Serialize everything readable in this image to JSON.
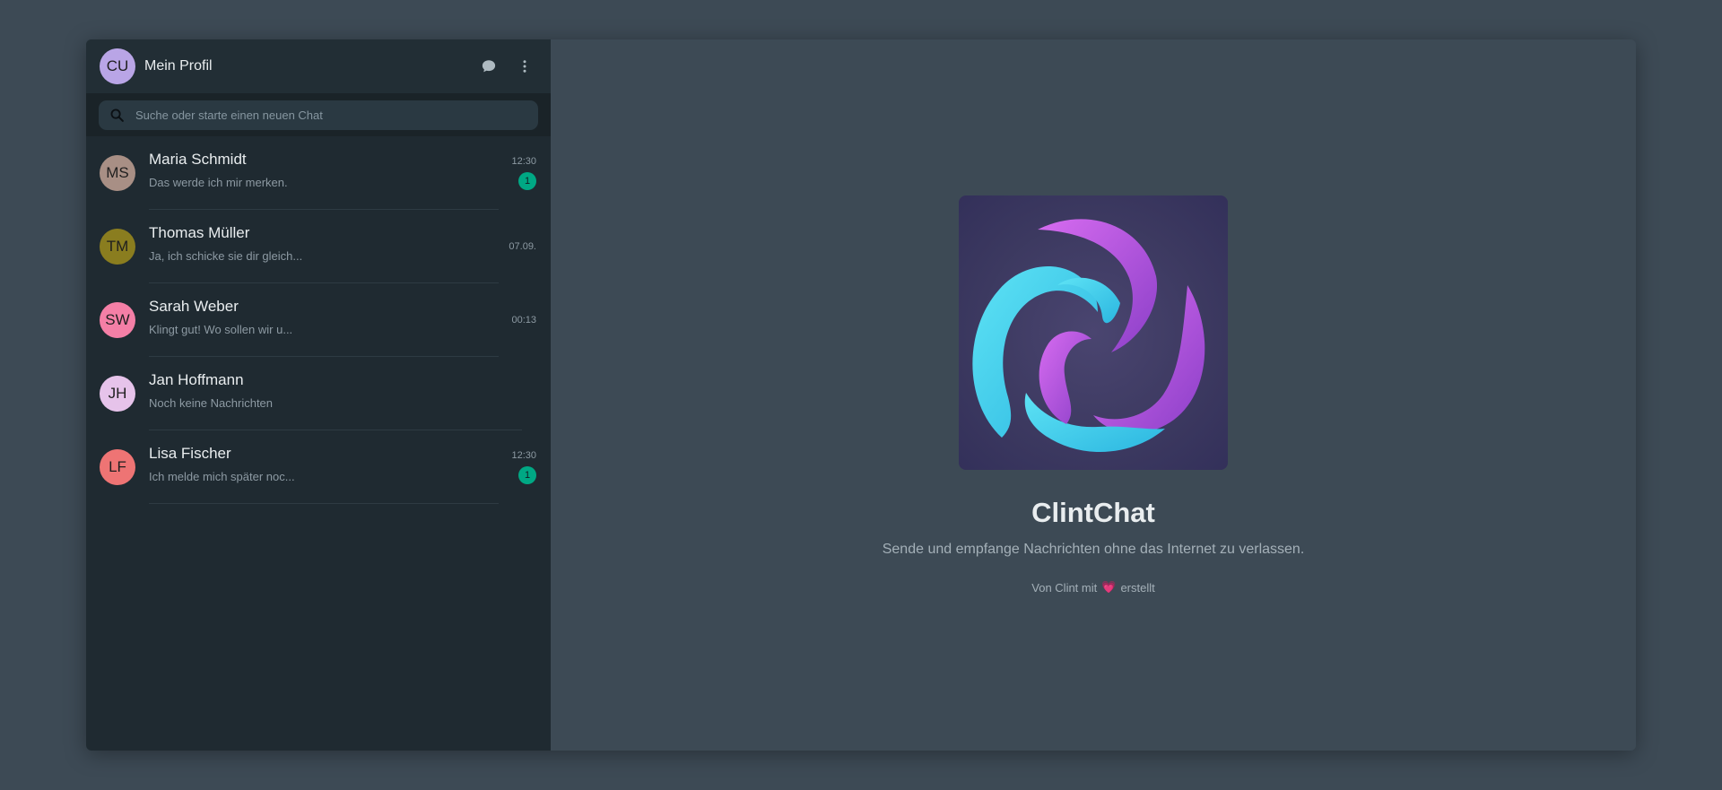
{
  "profile": {
    "initials": "CU",
    "name": "Mein Profil",
    "avatar_color": "#b9a5e6"
  },
  "header": {
    "new_chat_icon": "chat-bubble-icon",
    "menu_icon": "more-vertical-icon"
  },
  "search": {
    "placeholder": "Suche oder starte einen neuen Chat",
    "icon": "search-icon"
  },
  "chats": [
    {
      "initials": "MS",
      "name": "Maria Schmidt",
      "message": "Das werde ich mir merken.",
      "time": "12:30",
      "unread": "1",
      "avatar_color": "#a88f85"
    },
    {
      "initials": "TM",
      "name": "Thomas Müller",
      "message": "Ja, ich schicke sie dir gleich...",
      "time": "07.09.",
      "unread": "",
      "avatar_color": "#8a7d1f"
    },
    {
      "initials": "SW",
      "name": "Sarah Weber",
      "message": "Klingt gut! Wo sollen wir u...",
      "time": "00:13",
      "unread": "",
      "avatar_color": "#f47fa6"
    },
    {
      "initials": "JH",
      "name": "Jan Hoffmann",
      "message": "Noch keine Nachrichten",
      "time": "",
      "unread": "",
      "avatar_color": "#e6c3ea"
    },
    {
      "initials": "LF",
      "name": "Lisa Fischer",
      "message": "Ich melde mich später noc...",
      "time": "12:30",
      "unread": "1",
      "avatar_color": "#ee7474"
    }
  ],
  "welcome": {
    "title": "ClintChat",
    "subtitle": "Sende und empfange Nachrichten ohne das Internet zu verlassen.",
    "credit_prefix": "Von Clint mit",
    "credit_suffix": "erstellt",
    "heart": "💗"
  },
  "colors": {
    "accent": "#00a884",
    "sidebar_bg": "#1f2a31",
    "main_bg": "#3d4a55"
  }
}
